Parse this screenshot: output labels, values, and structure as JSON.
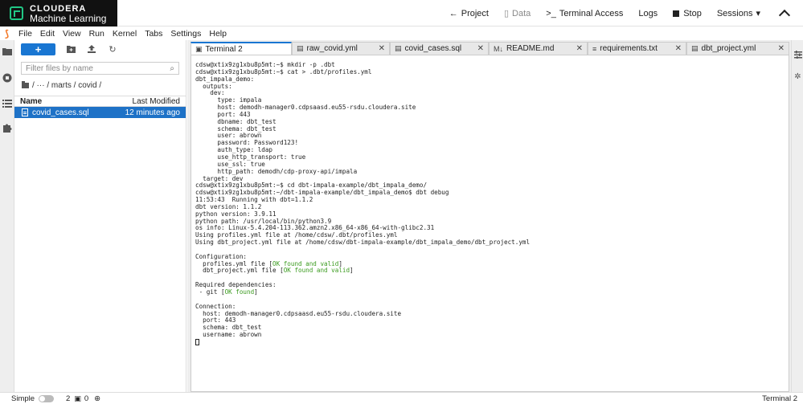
{
  "topbar": {
    "brand": "CLOUDERA",
    "product": "Machine Learning",
    "actions": {
      "project": "Project",
      "data": "Data",
      "terminal_access": "Terminal Access",
      "logs": "Logs",
      "stop": "Stop",
      "sessions": "Sessions"
    }
  },
  "menubar": {
    "items": [
      "File",
      "Edit",
      "View",
      "Run",
      "Kernel",
      "Tabs",
      "Settings",
      "Help"
    ]
  },
  "filebrowser": {
    "new_label": "+",
    "filter_placeholder": "Filter files by name",
    "breadcrumb": "/  ···  / marts / covid /",
    "header_name": "Name",
    "header_modified": "Last Modified",
    "files": [
      {
        "name": "covid_cases.sql",
        "modified": "12 minutes ago",
        "selected": true
      }
    ]
  },
  "tabs": [
    {
      "label": "Terminal 2",
      "active": true
    },
    {
      "label": "raw_covid.yml",
      "active": false
    },
    {
      "label": "covid_cases.sql",
      "active": false
    },
    {
      "label": "README.md",
      "active": false
    },
    {
      "label": "requirements.txt",
      "active": false
    },
    {
      "label": "dbt_project.yml",
      "active": false
    }
  ],
  "terminal": {
    "lines": [
      "cdsw@xtix9zg1xbu8p5mt:~$ mkdir -p .dbt",
      "cdsw@xtix9zg1xbu8p5mt:~$ cat > .dbt/profiles.yml",
      "dbt_impala_demo:",
      "  outputs:",
      "    dev:",
      "      type: impala",
      "      host: demodh-manager0.cdpsaasd.eu55-rsdu.cloudera.site",
      "      port: 443",
      "      dbname: dbt_test",
      "      schema: dbt_test",
      "      user: abrown",
      "      password: Password123!",
      "      auth_type: ldap",
      "      use_http_transport: true",
      "      use_ssl: true",
      "      http_path: demodh/cdp-proxy-api/impala",
      "  target: dev",
      "cdsw@xtix9zg1xbu8p5mt:~$ cd dbt-impala-example/dbt_impala_demo/",
      "cdsw@xtix9zg1xbu8p5mt:~/dbt-impala-example/dbt_impala_demo$ dbt debug",
      "11:53:43  Running with dbt=1.1.2",
      "dbt version: 1.1.2",
      "python version: 3.9.11",
      "python path: /usr/local/bin/python3.9",
      "os info: Linux-5.4.204-113.362.amzn2.x86_64-x86_64-with-glibc2.31",
      "Using profiles.yml file at /home/cdsw/.dbt/profiles.yml",
      "Using dbt_project.yml file at /home/cdsw/dbt-impala-example/dbt_impala_demo/dbt_project.yml",
      "",
      "Configuration:",
      "  profiles.yml file [",
      "  dbt_project.yml file [",
      "",
      "Required dependencies:",
      " - git [",
      "",
      "Connection:",
      "  host: demodh-manager0.cdpsaasd.eu55-rsdu.cloudera.site",
      "  port: 443",
      "  schema: dbt_test",
      "  username: abrown"
    ],
    "ok_valid": "OK found and valid",
    "ok_found": "OK found",
    "close_bracket": "]"
  },
  "statusbar": {
    "mode": "Simple",
    "kernels": "2",
    "terminals": "0",
    "current": "Terminal 2"
  },
  "colors": {
    "accent": "#1976d2",
    "ok_green": "#3b9b1f",
    "brand_green": "#21c785"
  }
}
